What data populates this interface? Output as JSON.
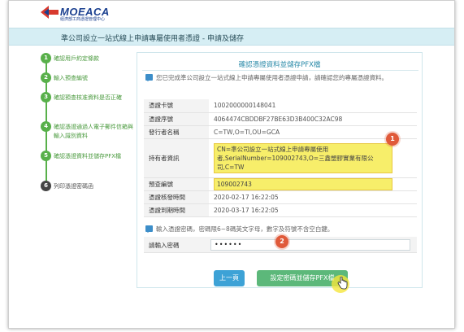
{
  "brand": {
    "name": "MOEACA",
    "subtitle": "經濟部工商憑證管理中心"
  },
  "page_title": "準公司設立一站式線上申請專屬使用者憑證 - 申請及儲存",
  "steps": [
    {
      "num": "1",
      "label": "確認用戶約定條款"
    },
    {
      "num": "2",
      "label": "輸入預查編號"
    },
    {
      "num": "3",
      "label": "確認預查核准資料是否正確"
    },
    {
      "num": "4",
      "label": "確認憑證通過人電子郵件信箱與輸入識別資料"
    },
    {
      "num": "5",
      "label": "確認憑證資料並儲存PFX檔"
    },
    {
      "num": "6",
      "label": "列印憑證密碼函"
    }
  ],
  "panel": {
    "title": "確認憑證資料並儲存PFX檔",
    "intro": "您已完成準公司設立一站式線上申請專屬使用者憑證申請，請確認您的專屬憑證資料。",
    "rows": [
      {
        "key": "憑證卡號",
        "value": "1002000000148041"
      },
      {
        "key": "憑證序號",
        "value": "4064474CBDDBF27BE63D3B400C32AC98"
      },
      {
        "key": "發行者名稱",
        "value": "C=TW,O=TI,OU=GCA"
      },
      {
        "key": "持有者資訊",
        "value": "CN=準公司設立一站式線上申請專屬使用者,SerialNumber=109002743,O=三鑫塑膠實業有限公司,C=TW"
      },
      {
        "key": "預查編號",
        "value": "109002743"
      },
      {
        "key": "憑證核發時間",
        "value": "2020-02-17 16:22:05"
      },
      {
        "key": "憑證到期時間",
        "value": "2020-03-17 16:22:05"
      }
    ],
    "password_note": "輸入憑證密碼，密碼限6~8碼英文字母，數字及符號不含空白鍵。",
    "password_label": "請輸入密碼",
    "password_value": "••••••"
  },
  "badges": {
    "one": "1",
    "two": "2"
  },
  "buttons": {
    "prev": "上一頁",
    "save": "設定密碼並儲存PFX檔"
  },
  "colors": {
    "accent_green": "#58b04a",
    "title_bar": "#d6eef4",
    "highlight": "#f7ee6a",
    "badge": "#e05a3a",
    "prev_button": "#3da2d6",
    "save_button": "#5cb87a"
  }
}
